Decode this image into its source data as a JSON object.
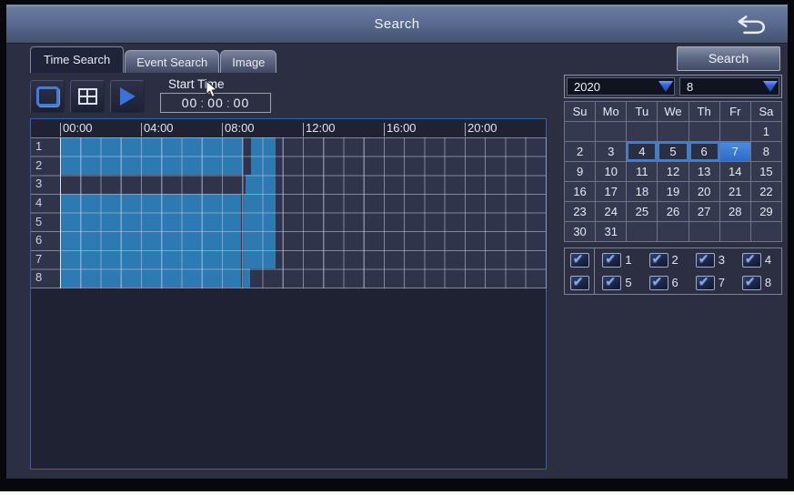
{
  "window": {
    "title": "Search"
  },
  "icons": {
    "back": "return-arrow",
    "check_glyph": "✔"
  },
  "tabs": [
    {
      "label": "Time Search",
      "active": true
    },
    {
      "label": "Event Search",
      "active": false
    },
    {
      "label": "Image",
      "active": false
    }
  ],
  "search_button": {
    "label": "Search"
  },
  "start_time": {
    "label": "Start Time",
    "hours": "00",
    "minutes": "00",
    "seconds": "00",
    "separator": ":"
  },
  "timeline": {
    "hours_total": 24,
    "hour_labels": [
      {
        "hour": 0,
        "label": "00:00"
      },
      {
        "hour": 4,
        "label": "04:00"
      },
      {
        "hour": 8,
        "label": "08:00"
      },
      {
        "hour": 12,
        "label": "12:00"
      },
      {
        "hour": 16,
        "label": "16:00"
      },
      {
        "hour": 20,
        "label": "20:00"
      }
    ],
    "channels": [
      {
        "id": "1",
        "segments": [
          [
            0,
            9.05
          ],
          [
            9.45,
            10.65
          ]
        ]
      },
      {
        "id": "2",
        "segments": [
          [
            0,
            9.05
          ],
          [
            9.45,
            10.65
          ]
        ]
      },
      {
        "id": "3",
        "segments": [
          [
            9.15,
            10.65
          ]
        ]
      },
      {
        "id": "4",
        "segments": [
          [
            0,
            8.95
          ],
          [
            9.1,
            10.65
          ]
        ]
      },
      {
        "id": "5",
        "segments": [
          [
            0,
            8.95
          ],
          [
            9.1,
            10.65
          ]
        ]
      },
      {
        "id": "6",
        "segments": [
          [
            0,
            8.95
          ],
          [
            9.1,
            10.65
          ]
        ]
      },
      {
        "id": "7",
        "segments": [
          [
            0,
            8.95
          ],
          [
            9.1,
            10.65
          ]
        ]
      },
      {
        "id": "8",
        "segments": [
          [
            0,
            8.95
          ],
          [
            9.1,
            9.4
          ]
        ]
      }
    ]
  },
  "calendar": {
    "year": "2020",
    "month": "8",
    "day_headers": [
      "Su",
      "Mo",
      "Tu",
      "We",
      "Th",
      "Fr",
      "Sa"
    ],
    "weeks": [
      [
        "",
        "",
        "",
        "",
        "",
        "",
        "1"
      ],
      [
        "2",
        "3",
        "4",
        "5",
        "6",
        "7",
        "8"
      ],
      [
        "9",
        "10",
        "11",
        "12",
        "13",
        "14",
        "15"
      ],
      [
        "16",
        "17",
        "18",
        "19",
        "20",
        "21",
        "22"
      ],
      [
        "23",
        "24",
        "25",
        "26",
        "27",
        "28",
        "29"
      ],
      [
        "30",
        "31",
        "",
        "",
        "",
        "",
        ""
      ]
    ],
    "days_with_recordings": [
      "4",
      "5",
      "6"
    ],
    "selected_day": "7"
  },
  "channel_checkboxes": {
    "rows": [
      {
        "master": {
          "checked": true
        },
        "channels": [
          {
            "label": "1",
            "checked": true
          },
          {
            "label": "2",
            "checked": true
          },
          {
            "label": "3",
            "checked": true
          },
          {
            "label": "4",
            "checked": true
          }
        ]
      },
      {
        "master": {
          "checked": true
        },
        "channels": [
          {
            "label": "5",
            "checked": true
          },
          {
            "label": "6",
            "checked": true
          },
          {
            "label": "7",
            "checked": true
          },
          {
            "label": "8",
            "checked": true
          }
        ]
      }
    ]
  },
  "colors": {
    "recording_blue": "#2d7ab3",
    "highlight_blue": "#3c7fd6",
    "selected_day_top": "#4a8ce0",
    "selected_day_bottom": "#2f68c4",
    "titlebar_top": "#6a7ba0",
    "titlebar_bottom": "#44526e",
    "panel_border": "#3d5fa6"
  }
}
